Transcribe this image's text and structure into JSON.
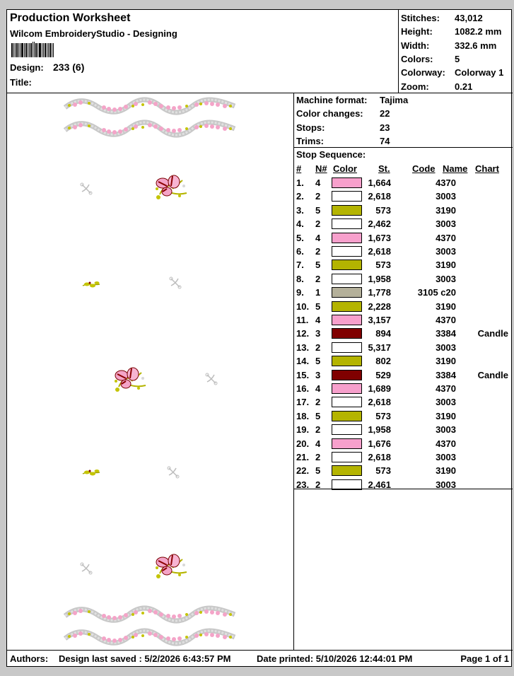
{
  "header": {
    "title": "Production Worksheet",
    "software": "Wilcom EmbroideryStudio - Designing",
    "design_label": "Design:",
    "design_value": "233 (6)",
    "title_label": "Title:"
  },
  "summary": [
    {
      "label": "Stitches:",
      "value": "43,012"
    },
    {
      "label": "Height:",
      "value": "1082.2 mm"
    },
    {
      "label": "Width:",
      "value": "332.6 mm"
    },
    {
      "label": "Colors:",
      "value": "5"
    },
    {
      "label": "Colorway:",
      "value": "Colorway 1"
    },
    {
      "label": "Zoom:",
      "value": "0.21"
    }
  ],
  "machine": [
    {
      "label": "Machine format:",
      "value": "Tajima"
    },
    {
      "label": "Color changes:",
      "value": "22"
    },
    {
      "label": "Stops:",
      "value": "23"
    },
    {
      "label": "Trims:",
      "value": "74"
    }
  ],
  "sequence": {
    "title": "Stop Sequence:",
    "headers": {
      "num": "#",
      "needle": "N#",
      "color": "Color",
      "stitches": "St.",
      "code": "Code",
      "name": "Name",
      "chart": "Chart"
    },
    "rows": [
      {
        "num": "1.",
        "needle": "4",
        "color": "#f7a0cc",
        "stitches": "1,664",
        "code": "4370",
        "chart": ""
      },
      {
        "num": "2.",
        "needle": "2",
        "color": "#ffffff",
        "stitches": "2,618",
        "code": "3003",
        "chart": ""
      },
      {
        "num": "3.",
        "needle": "5",
        "color": "#b4b400",
        "stitches": "573",
        "code": "3190",
        "chart": ""
      },
      {
        "num": "4.",
        "needle": "2",
        "color": "#ffffff",
        "stitches": "2,462",
        "code": "3003",
        "chart": ""
      },
      {
        "num": "5.",
        "needle": "4",
        "color": "#f7a0cc",
        "stitches": "1,673",
        "code": "4370",
        "chart": ""
      },
      {
        "num": "6.",
        "needle": "2",
        "color": "#ffffff",
        "stitches": "2,618",
        "code": "3003",
        "chart": ""
      },
      {
        "num": "7.",
        "needle": "5",
        "color": "#b4b400",
        "stitches": "573",
        "code": "3190",
        "chart": ""
      },
      {
        "num": "8.",
        "needle": "2",
        "color": "#ffffff",
        "stitches": "1,958",
        "code": "3003",
        "chart": ""
      },
      {
        "num": "9.",
        "needle": "1",
        "color": "#b4b09a",
        "stitches": "1,778",
        "code": "3105 c20",
        "chart": ""
      },
      {
        "num": "10.",
        "needle": "5",
        "color": "#b4b400",
        "stitches": "2,228",
        "code": "3190",
        "chart": ""
      },
      {
        "num": "11.",
        "needle": "4",
        "color": "#f7a0cc",
        "stitches": "3,157",
        "code": "4370",
        "chart": ""
      },
      {
        "num": "12.",
        "needle": "3",
        "color": "#800000",
        "stitches": "894",
        "code": "3384",
        "chart": "Candle"
      },
      {
        "num": "13.",
        "needle": "2",
        "color": "#ffffff",
        "stitches": "5,317",
        "code": "3003",
        "chart": ""
      },
      {
        "num": "14.",
        "needle": "5",
        "color": "#b4b400",
        "stitches": "802",
        "code": "3190",
        "chart": ""
      },
      {
        "num": "15.",
        "needle": "3",
        "color": "#800000",
        "stitches": "529",
        "code": "3384",
        "chart": "Candle"
      },
      {
        "num": "16.",
        "needle": "4",
        "color": "#f7a0cc",
        "stitches": "1,689",
        "code": "4370",
        "chart": ""
      },
      {
        "num": "17.",
        "needle": "2",
        "color": "#ffffff",
        "stitches": "2,618",
        "code": "3003",
        "chart": ""
      },
      {
        "num": "18.",
        "needle": "5",
        "color": "#b4b400",
        "stitches": "573",
        "code": "3190",
        "chart": ""
      },
      {
        "num": "19.",
        "needle": "2",
        "color": "#ffffff",
        "stitches": "1,958",
        "code": "3003",
        "chart": ""
      },
      {
        "num": "20.",
        "needle": "4",
        "color": "#f7a0cc",
        "stitches": "1,676",
        "code": "4370",
        "chart": ""
      },
      {
        "num": "21.",
        "needle": "2",
        "color": "#ffffff",
        "stitches": "2,618",
        "code": "3003",
        "chart": ""
      },
      {
        "num": "22.",
        "needle": "5",
        "color": "#b4b400",
        "stitches": "573",
        "code": "3190",
        "chart": ""
      },
      {
        "num": "23.",
        "needle": "2",
        "color": "#ffffff",
        "stitches": "2,461",
        "code": "3003",
        "chart": ""
      }
    ]
  },
  "footer": {
    "authors": "Authors:",
    "saved": "Design last saved : 5/2/2026 6:43:57 PM",
    "printed": "Date printed: 5/10/2026 12:44:01 PM",
    "page": "Page 1 of 1"
  }
}
